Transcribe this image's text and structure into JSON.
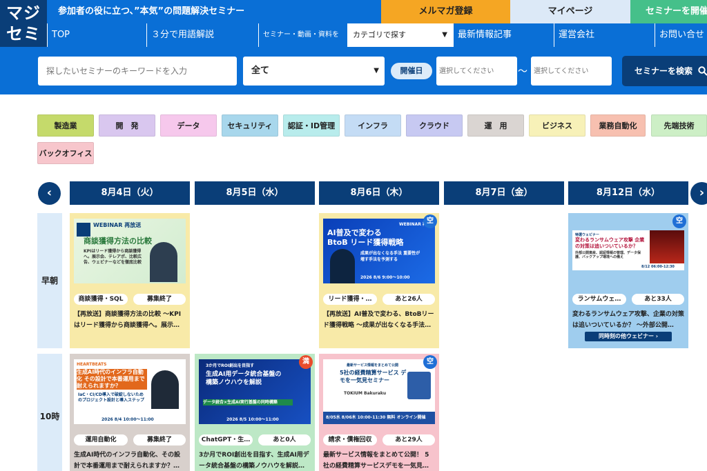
{
  "logo": {
    "line1": "マジ",
    "line2": "セミ"
  },
  "header": {
    "tagline": "参加者の役に立つ、”本気”の問題解決セミナー",
    "newsletter_label": "メルマガ登録",
    "mypage_label": "マイページ",
    "host_label": "セミナーを開催"
  },
  "nav": {
    "items": [
      "TOP",
      "３分で用語解説",
      "セミナー・動画・資料を",
      "最新情報記事",
      "運営会社",
      "お問い合せ"
    ],
    "category_select": "カテゴリで探す"
  },
  "search": {
    "keyword_placeholder": "探したいセミナーのキーワードを入力",
    "type_value": "全て",
    "date_pill": "開催日",
    "date_from_placeholder": "選択してください",
    "tilde": "〜",
    "date_to_placeholder": "選択してください",
    "submit_label": "セミナーを検索"
  },
  "categories": [
    {
      "label": "製造業",
      "color": "#c5da6b"
    },
    {
      "label": "開　発",
      "color": "#d9c7ef"
    },
    {
      "label": "データ",
      "color": "#f6c8ec"
    },
    {
      "label": "セキュリティ",
      "color": "#a8d7ec"
    },
    {
      "label": "認証・ID管理",
      "color": "#b8ecec"
    },
    {
      "label": "インフラ",
      "color": "#c4dcf5"
    },
    {
      "label": "クラウド",
      "color": "#c7c9f2"
    },
    {
      "label": "運　用",
      "color": "#dad5d2"
    },
    {
      "label": "ビジネス",
      "color": "#f7f1b8"
    },
    {
      "label": "業務自動化",
      "color": "#f7c0b0"
    },
    {
      "label": "先端技術",
      "color": "#cdefc6"
    },
    {
      "label": "バックオフィス",
      "color": "#f7c6cc"
    }
  ],
  "calendar": {
    "prev_label": "‹",
    "next_label": "›",
    "days": [
      "8月4日（火）",
      "8月5日（水）",
      "8月6日（木）",
      "8月7日（金）",
      "8月12日（水）"
    ],
    "slots": [
      "早朝",
      "10時"
    ]
  },
  "cards": [
    {
      "tag1": "商談獲得・SQL",
      "tag2": "募集終了",
      "title": "【再放送】商談獲得方法の比較 ～KPIはリード獲得から商談獲得へ。展示…",
      "bg": "#f8eaa8",
      "thumb": {
        "kicker": "WEBINAR 再放送",
        "headline": "商談獲得方法の比較",
        "sub": "KPIはリード獲得から商談獲得へ。展示会、テレアポ、比較広告、ウェビナーなどを徹底比較"
      }
    },
    {
      "tag1": "リード獲得・…",
      "tag2": "あと26人",
      "badge": "空",
      "title": "【再放送】AI普及で変わる、BtoBリード獲得戦略 ～成果が出なくなる手法…",
      "bg": "#f8eaa8",
      "thumb": {
        "kicker": "WEBINAR 再放送",
        "headline": "AI普及で変わる BtoB リード獲得戦略",
        "sub": "成果が出なくなる手法 重要性が増す手法を予測する",
        "date": "2026 8/6 9:00～10:00"
      }
    },
    {
      "tag1": "ランサムウェ…",
      "tag2": "あと33人",
      "badge": "空",
      "title": "変わるランサムウェア攻撃、企業の対策は追いついているか？ ～外部公開…",
      "bg": "#9fcdee",
      "same_label": "同時刻の他ウェビナー ›",
      "thumb": {
        "kicker": "特選ウェビナー",
        "headline": "変わるランサムウェア攻撃 企業の対策は追いついているか？",
        "sub": "外部公開資産、認証情報の管理、データ保護、バックアップ環境への備え",
        "date": "8/12 06:00-12:30"
      }
    },
    {
      "tag1": "運用自動化",
      "tag2": "募集終了",
      "title": "生成AI時代のインフラ自動化、その設計で本番運用まで耐えられますか？…",
      "bg": "#d8d0cc",
      "thumb": {
        "kicker": "HEARTBEATS",
        "headline": "生成AI時代のインフラ自動化 その設計で本番運用まで耐えられますか？",
        "sub": "IaC・CI/CD導入で破綻しないためのプロジェクト設計と導入ステップ",
        "date": "2026 8/4 10:00～11:00"
      }
    },
    {
      "tag1": "ChatGPT・生…",
      "tag2": "あと0人",
      "badge": "満",
      "title": "3か月でROI創出を目指す、生成AI用データ統合基盤の構築ノウハウを解説…",
      "bg": "#bde8c6",
      "thumb": {
        "kicker": "3か月でROI創出を目指す",
        "headline": "生成AI用データ統合基盤の構築ノウハウを解説",
        "sub": "データ統合×生成AI実行基盤の同時構築",
        "date": "2026 8/5 10:00～11:00"
      }
    },
    {
      "tag1": "請求・債権回収",
      "tag2": "あと29人",
      "badge": "空",
      "title": "最新サービス情報をまとめて公開！ 5社の経費精算サービスデモを一気見…",
      "bg": "#f7c3cc",
      "thumb": {
        "kicker": "最新サービス情報をまとめて公開",
        "headline": "5社の経費精算サービス デモを一気見セミナー",
        "sub": "TOKIUM Bakuraku",
        "date": "8/05水 8/06木 10:00-11:30 無料 オンライン開催"
      }
    }
  ]
}
